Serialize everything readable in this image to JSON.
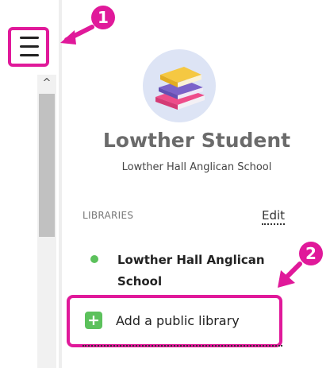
{
  "menu": {
    "icon": "hamburger-menu-icon"
  },
  "scrollbar": {
    "up_glyph": "^"
  },
  "profile": {
    "avatar_icon": "books-stack-icon",
    "name": "Lowther Student",
    "school": "Lowther Hall Anglican School"
  },
  "libraries": {
    "heading": "LIBRARIES",
    "edit_label": "Edit",
    "items": [
      {
        "name": "Lowther Hall Anglican School",
        "status_color": "#5cc15c"
      }
    ],
    "add_label": "Add a public library",
    "add_icon": "plus-icon"
  },
  "annotations": {
    "badge_1": "1",
    "badge_2": "2",
    "color": "#e0199a"
  }
}
